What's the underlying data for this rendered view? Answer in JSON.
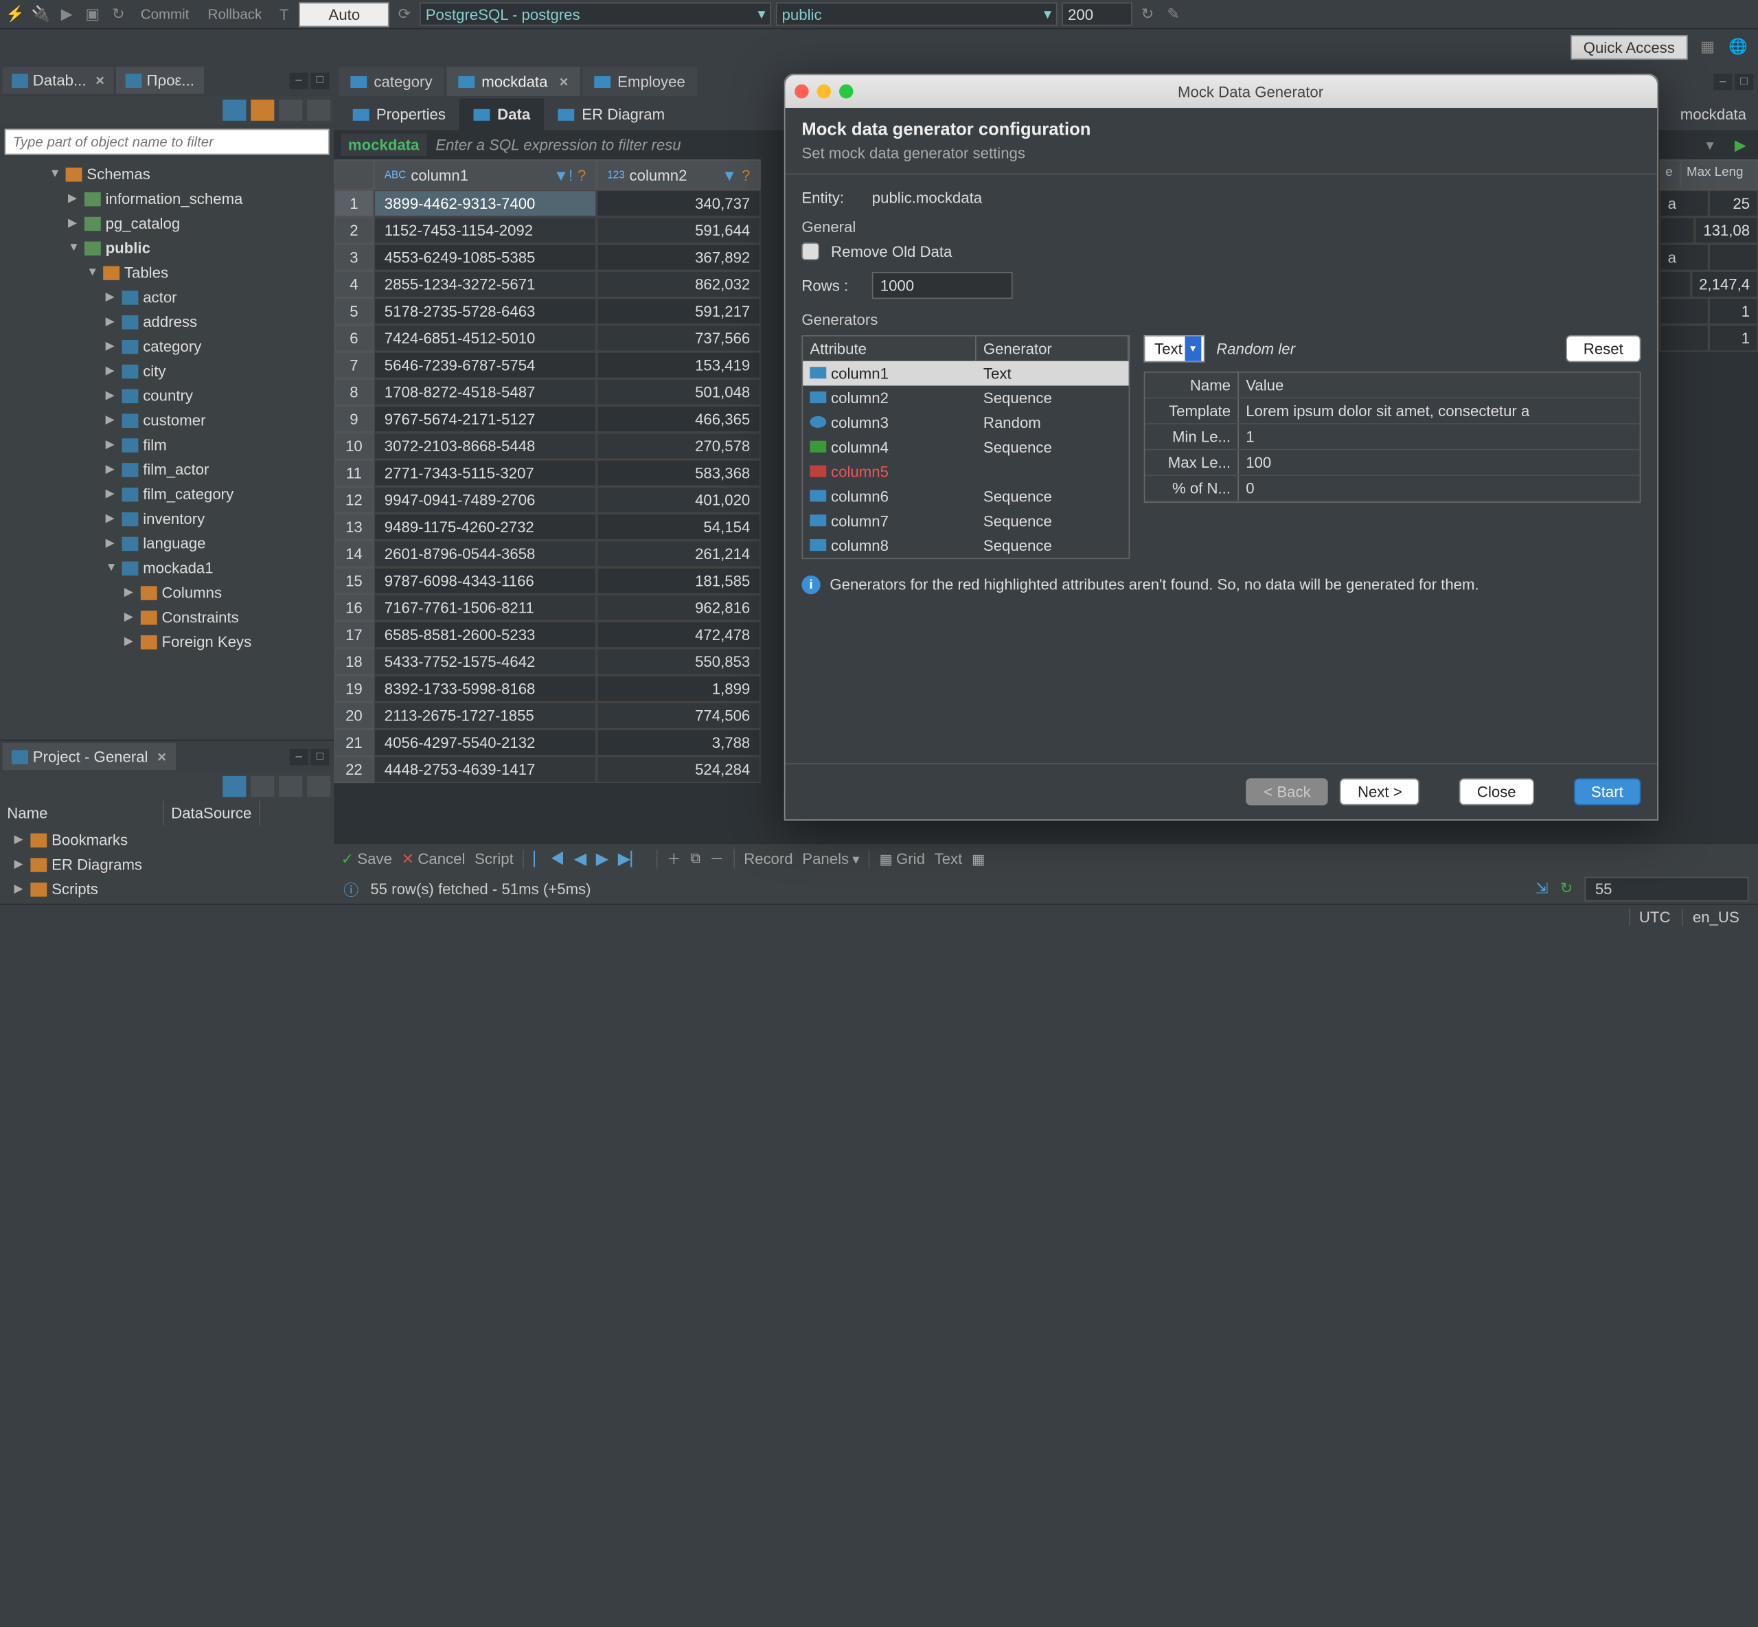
{
  "toolbar": {
    "commit": "Commit",
    "rollback": "Rollback",
    "auto": "Auto",
    "conn_combo": "PostgreSQL - postgres",
    "schema_combo": "public",
    "limit": "200",
    "quick_access": "Quick Access"
  },
  "views": {
    "db_nav": "Datab...",
    "projects": "Προε...",
    "filter_placeholder": "Type part of object name to filter"
  },
  "tree": {
    "schemas": "Schemas",
    "info_schema": "information_schema",
    "pg_catalog": "pg_catalog",
    "public": "public",
    "tables": "Tables",
    "items": [
      "actor",
      "address",
      "category",
      "city",
      "country",
      "customer",
      "film",
      "film_actor",
      "film_category",
      "inventory",
      "language",
      "mockada1"
    ],
    "sub": [
      "Columns",
      "Constraints",
      "Foreign Keys"
    ]
  },
  "project": {
    "title": "Project - General",
    "cols": [
      "Name",
      "DataSource"
    ],
    "items": [
      "Bookmarks",
      "ER Diagrams",
      "Scripts"
    ]
  },
  "editor": {
    "tabs": [
      "category",
      "mockdata",
      "Employee"
    ],
    "active": 1,
    "sub_tabs": [
      "Properties",
      "Data",
      "ER Diagram"
    ],
    "sub_active": 1,
    "filter_entity": "mockdata",
    "filter_hint": "Enter a SQL expression to filter resu"
  },
  "grid": {
    "columns": [
      "column1",
      "column2"
    ],
    "right_cols": [
      "e",
      "Max Leng"
    ],
    "rows": [
      [
        "3899-4462-9313-7400",
        "340,737"
      ],
      [
        "1152-7453-1154-2092",
        "591,644"
      ],
      [
        "4553-6249-1085-5385",
        "367,892"
      ],
      [
        "2855-1234-3272-5671",
        "862,032"
      ],
      [
        "5178-2735-5728-6463",
        "591,217"
      ],
      [
        "7424-6851-4512-5010",
        "737,566"
      ],
      [
        "5646-7239-6787-5754",
        "153,419"
      ],
      [
        "1708-8272-4518-5487",
        "501,048"
      ],
      [
        "9767-5674-2171-5127",
        "466,365"
      ],
      [
        "3072-2103-8668-5448",
        "270,578"
      ],
      [
        "2771-7343-5115-3207",
        "583,368"
      ],
      [
        "9947-0941-7489-2706",
        "401,020"
      ],
      [
        "9489-1175-4260-2732",
        "54,154"
      ],
      [
        "2601-8796-0544-3658",
        "261,214"
      ],
      [
        "9787-6098-4343-1166",
        "181,585"
      ],
      [
        "7167-7761-1506-8211",
        "962,816"
      ],
      [
        "6585-8581-2600-5233",
        "472,478"
      ],
      [
        "5433-7752-1575-4642",
        "550,853"
      ],
      [
        "8392-1733-5998-8168",
        "1,899"
      ],
      [
        "2113-2675-1727-1855",
        "774,506"
      ],
      [
        "4056-4297-5540-2132",
        "3,788"
      ],
      [
        "4448-2753-4639-1417",
        "524,284"
      ]
    ],
    "right_rows": [
      [
        "a",
        "25"
      ],
      [
        "",
        "131,08"
      ],
      [
        "a",
        ""
      ],
      [
        "",
        "2,147,4"
      ],
      [
        "",
        "1"
      ],
      [
        "",
        "1"
      ]
    ],
    "right_breadcrumb": "mockdata"
  },
  "grid_bottom": {
    "save": "Save",
    "cancel": "Cancel",
    "script": "Script",
    "record": "Record",
    "panels": "Panels",
    "grid": "Grid",
    "text": "Text"
  },
  "status": {
    "msg": "55 row(s) fetched - 51ms (+5ms)",
    "count": "55"
  },
  "bottom": {
    "tz": "UTC",
    "locale": "en_US"
  },
  "modal": {
    "window_title": "Mock Data Generator",
    "title": "Mock data generator configuration",
    "subtitle": "Set mock data generator settings",
    "entity_label": "Entity:",
    "entity": "public.mockdata",
    "section_general": "General",
    "remove_old": "Remove Old Data",
    "rows_label": "Rows :",
    "rows_value": "1000",
    "section_gen": "Generators",
    "attr_head": "Attribute",
    "gen_head": "Generator",
    "attrs": [
      {
        "name": "column1",
        "gen": "Text",
        "icon": "abc",
        "sel": true
      },
      {
        "name": "column2",
        "gen": "Sequence",
        "icon": "n123"
      },
      {
        "name": "column3",
        "gen": "Random",
        "icon": "clock"
      },
      {
        "name": "column4",
        "gen": "Sequence",
        "icon": "check"
      },
      {
        "name": "column5",
        "gen": "",
        "icon": "red",
        "red": true
      },
      {
        "name": "column6",
        "gen": "Sequence",
        "icon": "n123"
      },
      {
        "name": "column7",
        "gen": "Sequence",
        "icon": "n123"
      },
      {
        "name": "column8",
        "gen": "Sequence",
        "icon": "n123"
      }
    ],
    "type_select": "Text",
    "type_desc": "Random ler",
    "reset": "Reset",
    "pv_head": [
      "Name",
      "Value"
    ],
    "pv": [
      [
        "Template",
        "Lorem ipsum dolor sit amet, consectetur a"
      ],
      [
        "Min Le...",
        "1"
      ],
      [
        "Max Le...",
        "100"
      ],
      [
        "% of N...",
        "0"
      ]
    ],
    "note": "Generators for the red highlighted attributes aren't found. So, no data will be generated for them.",
    "back": "< Back",
    "next": "Next >",
    "close": "Close",
    "start": "Start"
  }
}
